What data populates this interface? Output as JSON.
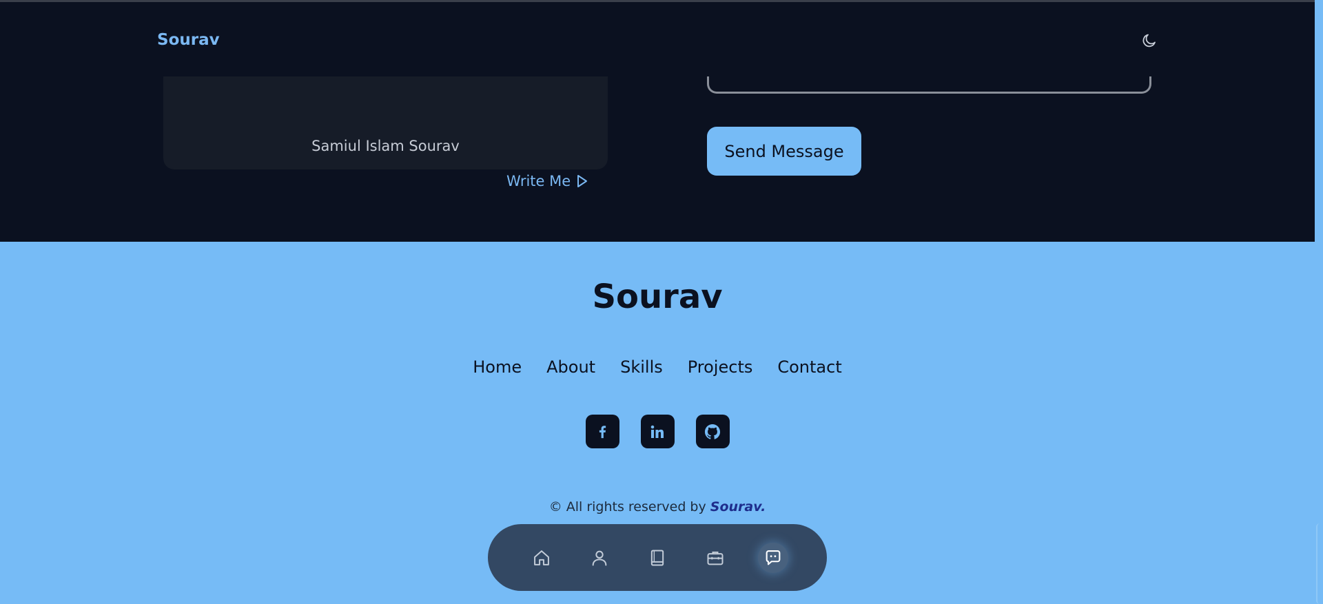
{
  "header": {
    "brand": "Sourav",
    "theme_icon": "moon-icon"
  },
  "contact_card": {
    "name": "Samiul Islam Sourav",
    "write_me_label": "Write Me",
    "write_me_icon": "play-outline-icon"
  },
  "form": {
    "send_label": "Send Message"
  },
  "footer": {
    "title": "Sourav",
    "nav": [
      "Home",
      "About",
      "Skills",
      "Projects",
      "Contact"
    ],
    "socials": [
      "facebook-icon",
      "linkedin-icon",
      "github-icon"
    ],
    "copyright_prefix": "© All rights reserved by",
    "copyright_name": "Sourav."
  },
  "bottom_nav": {
    "items": [
      "home-icon",
      "user-icon",
      "book-icon",
      "briefcase-icon",
      "chat-icon"
    ],
    "active": "chat-icon"
  },
  "colors": {
    "dark_bg": "#0b1120",
    "accent": "#76bbf6",
    "card_bg": "#161c28",
    "bottom_nav_bg": "#334863"
  }
}
